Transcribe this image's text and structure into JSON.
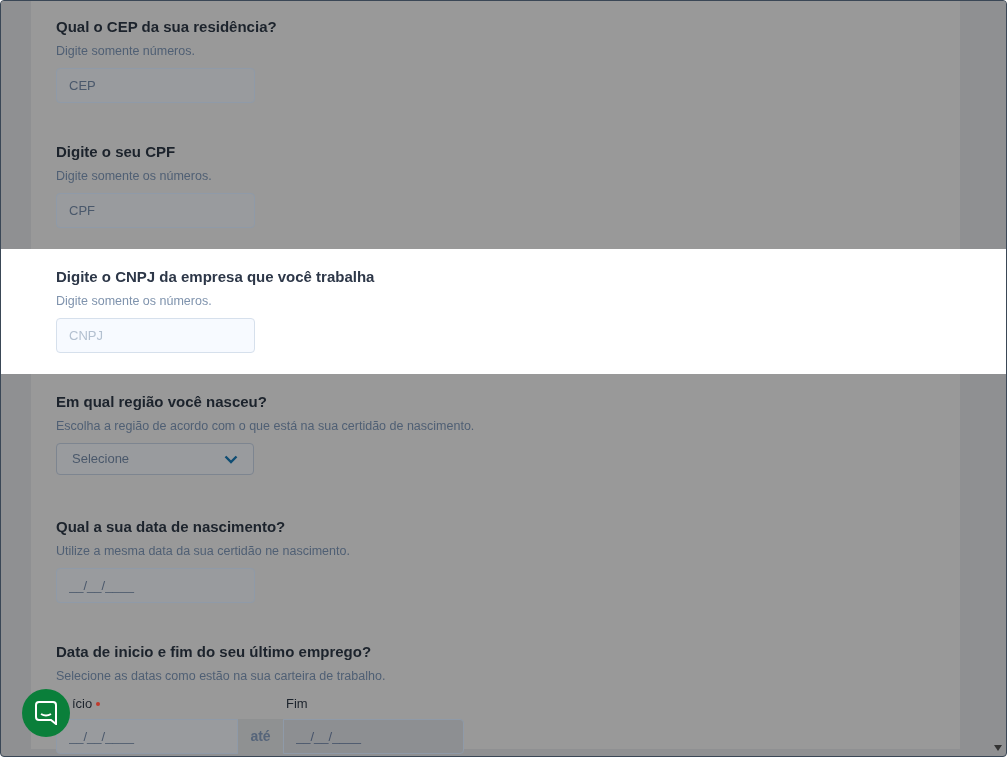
{
  "sections": [
    {
      "kind": "text",
      "title": "Qual o CEP da sua residência?",
      "hint": "Digite somente números.",
      "placeholder": "CEP",
      "highlighted": false
    },
    {
      "kind": "text",
      "title": "Digite o seu CPF",
      "hint": "Digite somente os números.",
      "placeholder": "CPF",
      "highlighted": false
    },
    {
      "kind": "text",
      "title": "Digite o CNPJ da empresa que você trabalha",
      "hint": "Digite somente os números.",
      "placeholder": "CNPJ",
      "highlighted": true
    },
    {
      "kind": "select",
      "title": "Em qual região você nasceu?",
      "hint": "Escolha a região de acordo com o que está na sua certidão de nascimento.",
      "placeholder": "Selecione",
      "highlighted": false
    },
    {
      "kind": "text",
      "title": "Qual a sua data de nascimento?",
      "hint": "Utilize a mesma data da sua certidão ne nascimento.",
      "placeholder": "__/__/____",
      "highlighted": false
    },
    {
      "kind": "date_range",
      "title": "Data de inicio e fim do seu último emprego?",
      "hint": "Selecione as datas como estão na sua carteira de trabalho.",
      "highlighted": false,
      "start": {
        "label": "ício",
        "required": true,
        "placeholder": "__/__/____",
        "disabled": false
      },
      "separator": "até",
      "end": {
        "label": "Fim",
        "placeholder": "__/__/____",
        "disabled": true
      }
    }
  ]
}
